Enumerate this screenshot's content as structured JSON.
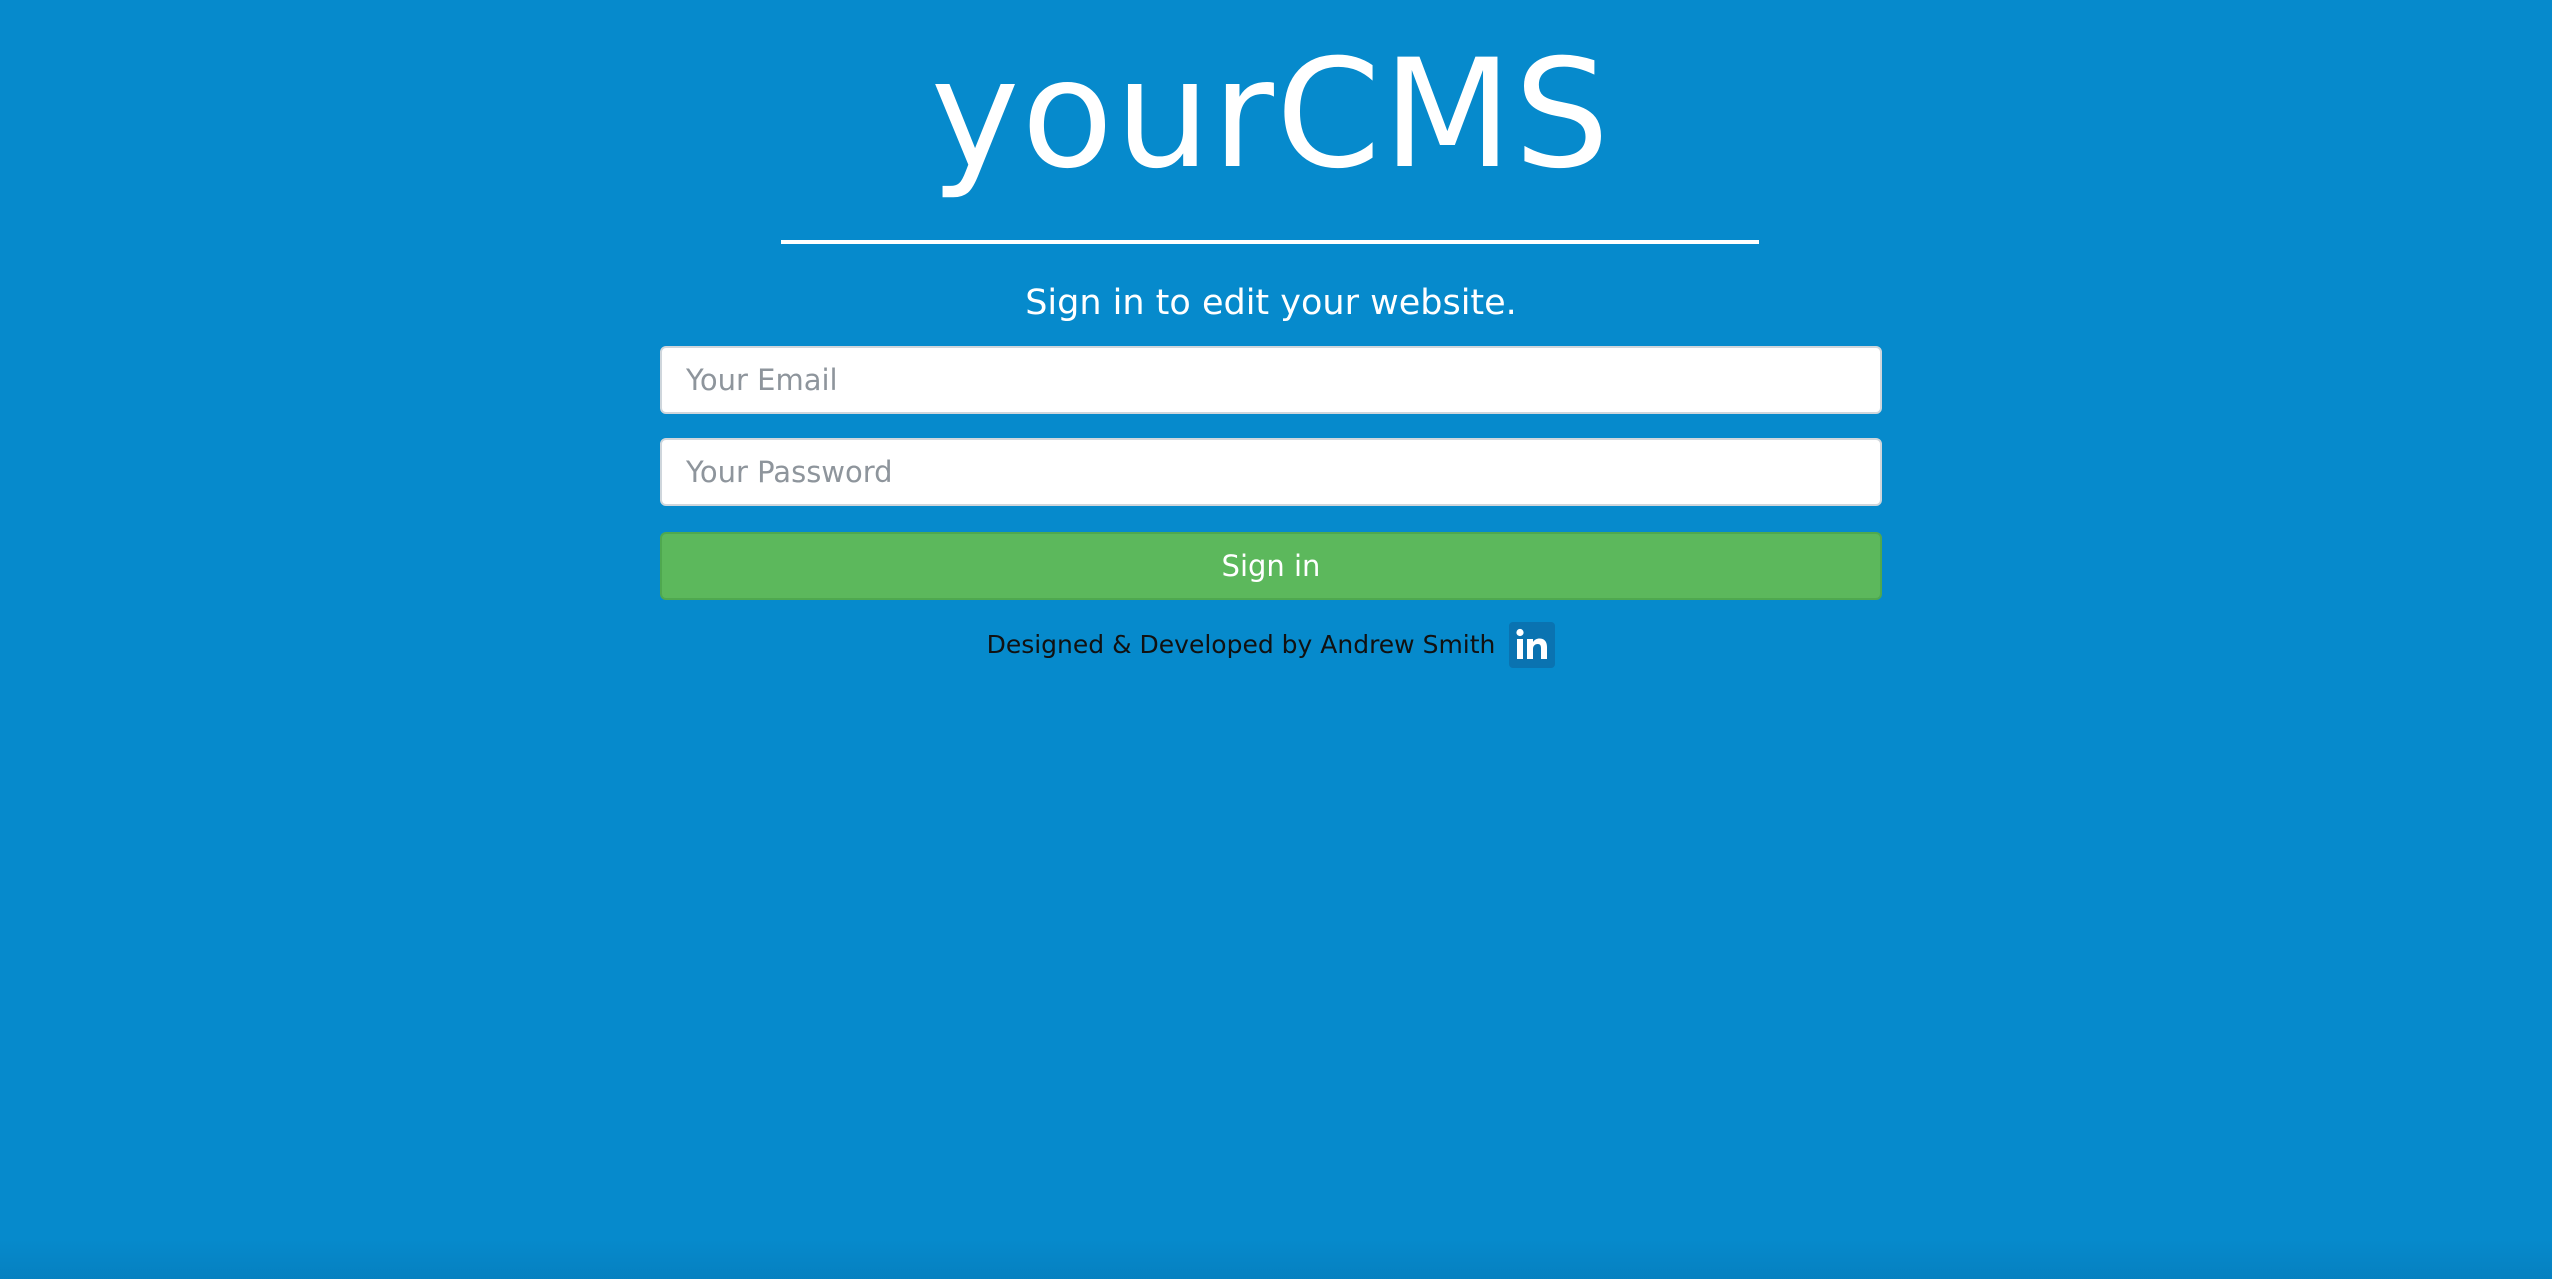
{
  "app": {
    "logo_text": "yourCMS",
    "subtitle": "Sign in to edit your website."
  },
  "form": {
    "email_placeholder": "Your Email",
    "email_value": "",
    "password_placeholder": "Your Password",
    "password_value": "",
    "submit_label": "Sign in"
  },
  "footer": {
    "credit": "Designed & Developed by Andrew Smith",
    "linkedin_icon": "linkedin-icon"
  },
  "colors": {
    "background": "#068acc",
    "button": "#5cb85c",
    "linkedin": "#0a73b1",
    "text_light": "#ffffff"
  }
}
